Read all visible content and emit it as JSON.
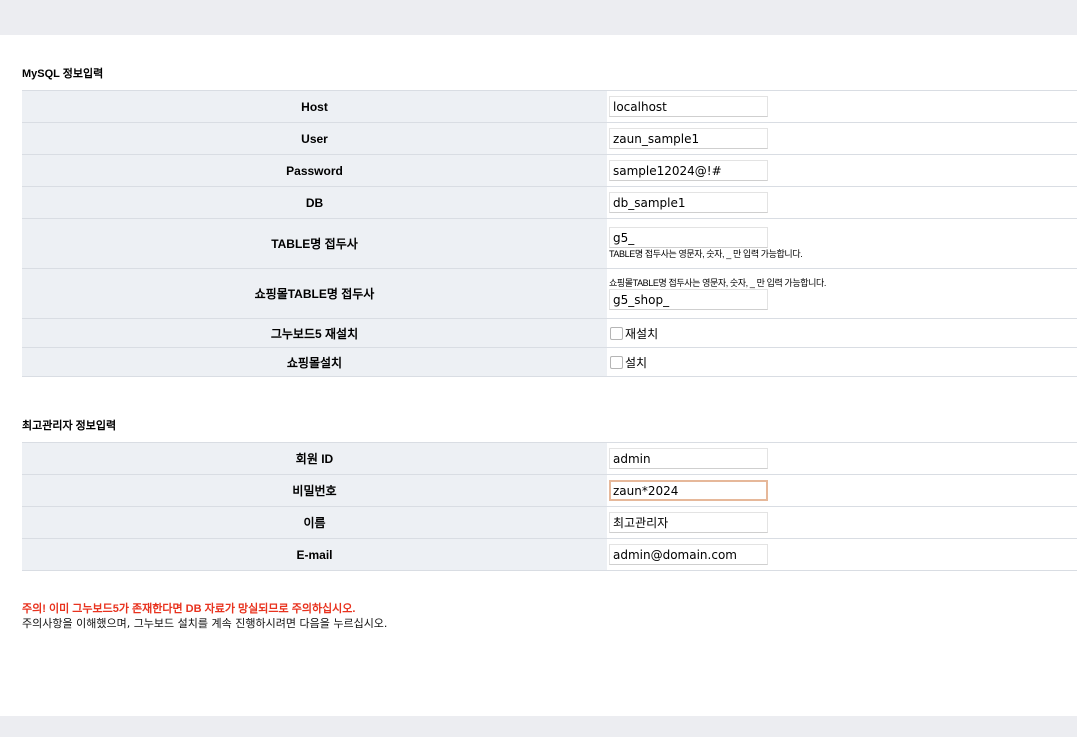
{
  "mysql": {
    "title": "MySQL 정보입력",
    "host_label": "Host",
    "host_value": "localhost",
    "user_label": "User",
    "user_value": "zaun_sample1",
    "password_label": "Password",
    "password_value": "sample12024@!#",
    "db_label": "DB",
    "db_value": "db_sample1",
    "prefix_label": "TABLE명 접두사",
    "prefix_value": "g5_",
    "prefix_help": "TABLE명 접두사는 영문자, 숫자, _ 만 입력 가능합니다.",
    "shop_prefix_label": "쇼핑몰TABLE명 접두사",
    "shop_prefix_help": "쇼핑몰TABLE명 접두사는 영문자, 숫자, _ 만 입력 가능합니다.",
    "shop_prefix_value": "g5_shop_",
    "reinstall_label": "그누보드5 재설치",
    "reinstall_checkbox_label": "재설치",
    "shop_install_label": "쇼핑몰설치",
    "shop_install_checkbox_label": "설치"
  },
  "admin": {
    "title": "최고관리자 정보입력",
    "id_label": "회원 ID",
    "id_value": "admin",
    "password_label": "비밀번호",
    "password_value": "zaun*2024",
    "name_label": "이름",
    "name_value": "최고관리자",
    "email_label": "E-mail",
    "email_value": "admin@domain.com"
  },
  "warning_text": "주의! 이미 그누보드5가 존재한다면 DB 자료가 망실되므로 주의하십시오.",
  "notice_text": "주의사항을 이해했으며, 그누보드 설치를 계속 진행하시려면 다음을 누르십시오.",
  "colors": {
    "warning": "#e8321e",
    "header_bg": "#edf0f4",
    "focus_border": "#e6b89a"
  }
}
